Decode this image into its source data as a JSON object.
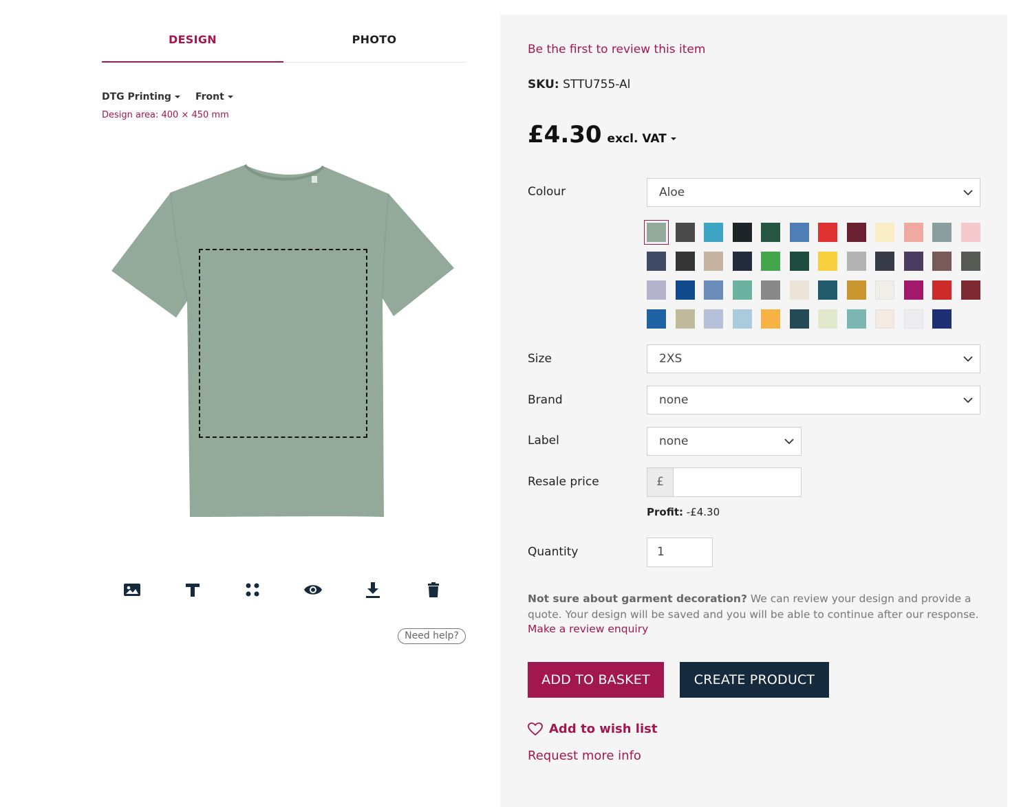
{
  "tabs": {
    "design": "DESIGN",
    "photo": "PHOTO"
  },
  "options": {
    "method": "DTG Printing",
    "side": "Front",
    "design_area": "Design area: 400 × 450 mm"
  },
  "help": "Need help?",
  "product": {
    "review_link": "Be the first to review this item",
    "sku_label": "SKU:",
    "sku_value": "STTU755-Al",
    "price": "£4.30",
    "vat": "excl. VAT"
  },
  "form": {
    "colour_label": "Colour",
    "colour_value": "Aloe",
    "size_label": "Size",
    "size_value": "2XS",
    "brand_label": "Brand",
    "brand_value": "none",
    "label_label": "Label",
    "label_value": "none",
    "resale_label": "Resale price",
    "currency_symbol": "£",
    "resale_value": "",
    "profit_label": "Profit:",
    "profit_value": "-£4.30",
    "quantity_label": "Quantity",
    "quantity_value": "1"
  },
  "colours": {
    "selected": "#93a99a",
    "shirt": "#93a99a",
    "swatches": [
      "#93a99a",
      "#4a4a4a",
      "#3da4c4",
      "#1e2528",
      "#265744",
      "#4f7db5",
      "#de3232",
      "#6a2030",
      "#faeec6",
      "#efa9a0",
      "#8a9ea0",
      "#f6c9cf",
      "#3f4a65",
      "#353535",
      "#c7b3a1",
      "#222b3b",
      "#43a64a",
      "#1e4b40",
      "#f8d03e",
      "#b3b3b3",
      "#363b47",
      "#4b3c5f",
      "#79595a",
      "#565a52",
      "#b4b3cc",
      "#114a8c",
      "#6a8cb8",
      "#6bb3a0",
      "#888888",
      "#ece3d9",
      "#225c6c",
      "#c9962f",
      "#f1eeea",
      "#a2196c",
      "#cd2a2c",
      "#7e2a33",
      "#1f62a4",
      "#c1bb9e",
      "#b6c0d8",
      "#aacbdb",
      "#f6b242",
      "#244a55",
      "#e2e8cc",
      "#7bb6b2",
      "#f3ebe3",
      "#ededef",
      "#1f2f74"
    ]
  },
  "note": {
    "bold": "Not sure about garment decoration?",
    "text": " We can review your design and provide a quote. Your design will be saved and you will be able to continue after our response.",
    "link": "Make a review enquiry"
  },
  "buttons": {
    "basket": "ADD TO BASKET",
    "create": "CREATE PRODUCT"
  },
  "links": {
    "wishlist": "Add to wish list",
    "more_info": "Request more info"
  },
  "toolbar_icons": [
    "image-icon",
    "text-icon",
    "layout-icon",
    "eye-icon",
    "download-icon",
    "trash-icon"
  ]
}
